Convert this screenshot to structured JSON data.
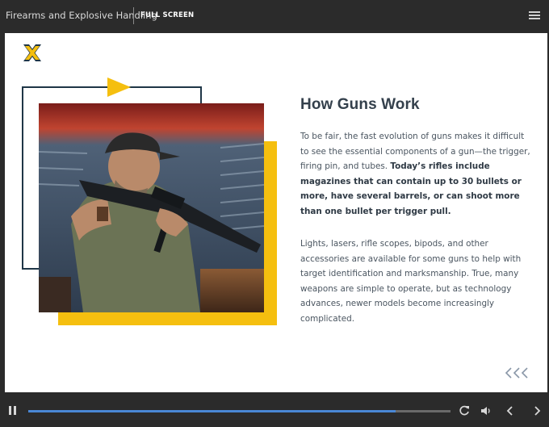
{
  "header": {
    "course_title": "Firearms and Explosive Handling",
    "fullscreen_label": "FULL SCREEN",
    "menu_icon": "hamburger-menu-icon"
  },
  "slide": {
    "logo_icon": "brand-x-logo-icon",
    "title": "How Guns Work",
    "paragraph1_plain": "To be fair, the fast evolution of guns makes it difficult to see the essential components of a gun—the trigger, firing pin, and tubes. ",
    "paragraph1_bold": "Today’s rifles include magazines that can contain up to 30 bullets or more, have several barrels, or can shoot more than one bullet per trigger pull.",
    "paragraph2": "Lights, lasers, rifle scopes, bipods, and other accessories are available for some guns to help with target identification and marksmanship. True, many weapons are simple to operate, but as technology advances, newer models become increasingly complicated.",
    "back_icon": "triple-chevron-left-icon"
  },
  "colors": {
    "accent_yellow": "#f5bf0f",
    "navy": "#1f3647",
    "progress_blue": "#4a88d6"
  },
  "player": {
    "progress": 0.87,
    "icons": [
      "pause-icon",
      "replay-icon",
      "volume-icon",
      "previous-icon",
      "next-icon"
    ]
  }
}
